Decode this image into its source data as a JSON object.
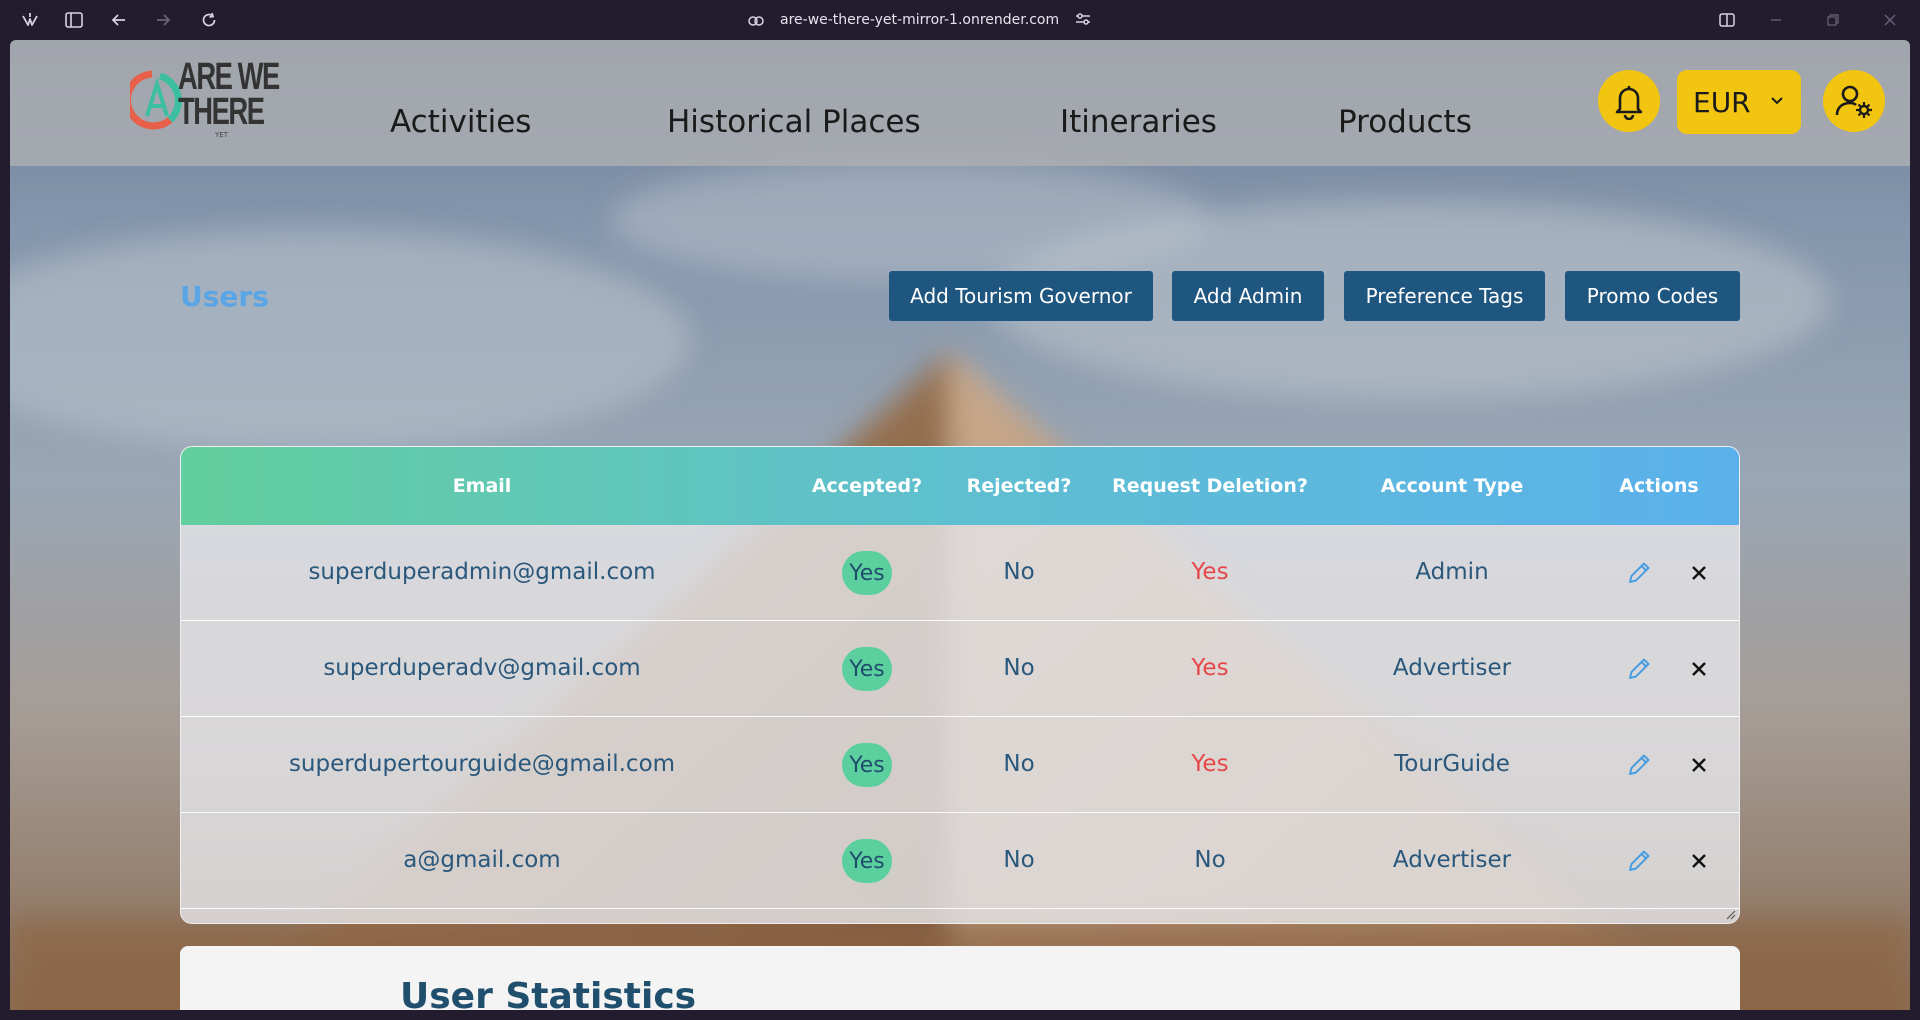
{
  "browser": {
    "url": "are-we-there-yet-mirror-1.onrender.com"
  },
  "logo": {
    "line1": "ARE WE",
    "line2": "THERE",
    "line3": "YET"
  },
  "nav": {
    "links": [
      "Activities",
      "Historical Places",
      "Itineraries",
      "Products"
    ],
    "currency": "EUR"
  },
  "page": {
    "title": "Users",
    "buttons": {
      "add_tourism_governor": "Add Tourism Governor",
      "add_admin": "Add Admin",
      "preference_tags": "Preference Tags",
      "promo_codes": "Promo Codes"
    }
  },
  "table": {
    "headers": [
      "Email",
      "Accepted?",
      "Rejected?",
      "Request Deletion?",
      "Account Type",
      "Actions"
    ],
    "rows": [
      {
        "email": "superduperadmin@gmail.com",
        "accepted": "Yes",
        "rejected": "No",
        "deletion": "Yes",
        "type": "Admin"
      },
      {
        "email": "superduperadv@gmail.com",
        "accepted": "Yes",
        "rejected": "No",
        "deletion": "Yes",
        "type": "Advertiser"
      },
      {
        "email": "superdupertourguide@gmail.com",
        "accepted": "Yes",
        "rejected": "No",
        "deletion": "Yes",
        "type": "TourGuide"
      },
      {
        "email": "a@gmail.com",
        "accepted": "Yes",
        "rejected": "No",
        "deletion": "No",
        "type": "Advertiser"
      }
    ]
  },
  "stats": {
    "title": "User Statistics"
  },
  "colors": {
    "accent_yellow": "#f2c511",
    "button_blue": "#1f5680",
    "yes_red": "#e84646",
    "pill_green": "#5bcf9e"
  }
}
